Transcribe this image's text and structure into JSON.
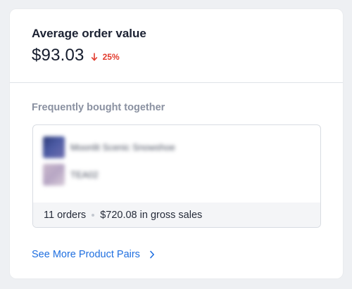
{
  "metric": {
    "label": "Average order value",
    "value": "$93.03",
    "trend_direction": "down",
    "trend_text": "25%",
    "trend_color": "#e23a2c"
  },
  "pairs": {
    "title": "Frequently bought together",
    "products": [
      {
        "name": "Moonlit Scenic Snowshoe",
        "thumbnail_icon": "product-thumbnail"
      },
      {
        "name": "TEA02",
        "thumbnail_icon": "product-thumbnail"
      }
    ],
    "orders": "11 orders",
    "gross_sales": "$720.08 in gross sales"
  },
  "link": {
    "label": "See More Product Pairs",
    "icon": "chevron-right-icon",
    "color": "#1f6fe0"
  }
}
